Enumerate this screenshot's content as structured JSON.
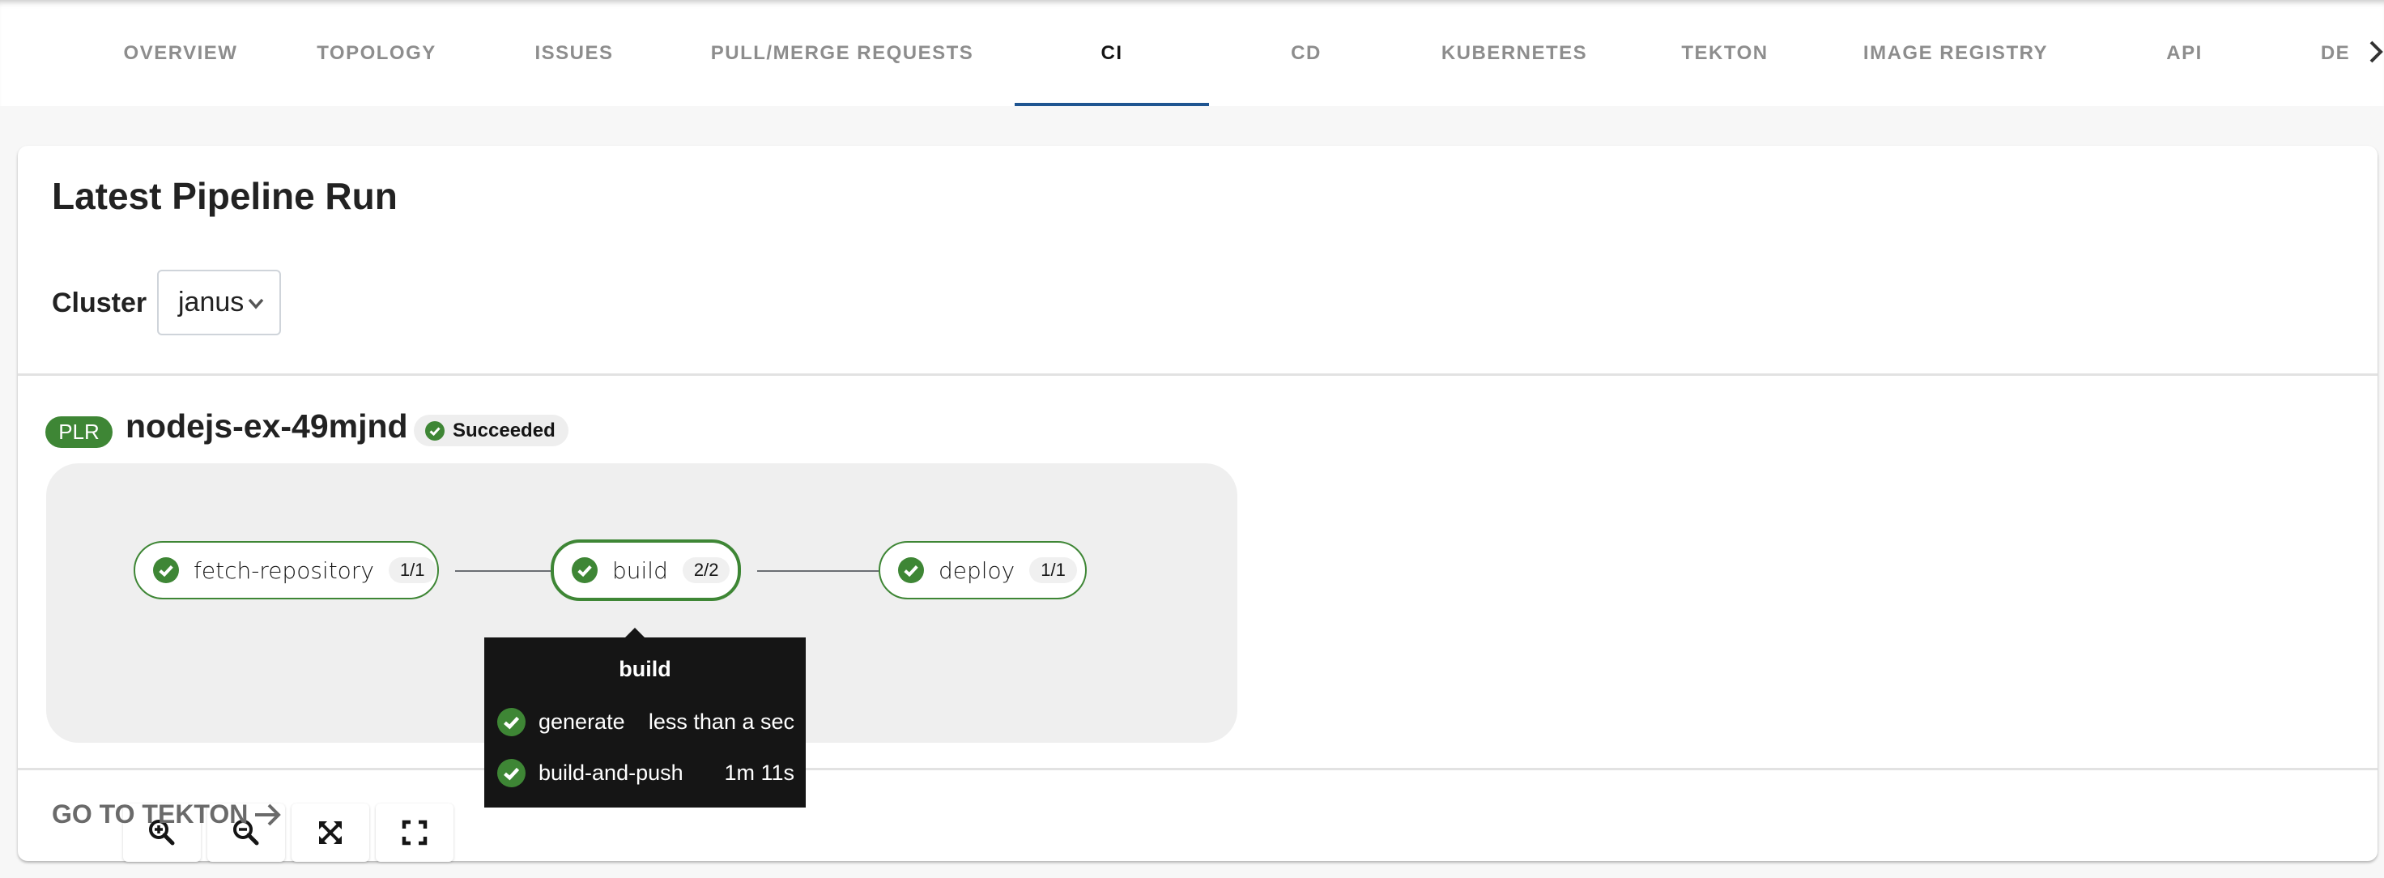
{
  "tabs": [
    {
      "label": "OVERVIEW",
      "active": false
    },
    {
      "label": "TOPOLOGY",
      "active": false
    },
    {
      "label": "ISSUES",
      "active": false
    },
    {
      "label": "PULL/MERGE REQUESTS",
      "active": false
    },
    {
      "label": "CI",
      "active": true
    },
    {
      "label": "CD",
      "active": false
    },
    {
      "label": "KUBERNETES",
      "active": false
    },
    {
      "label": "TEKTON",
      "active": false
    },
    {
      "label": "IMAGE REGISTRY",
      "active": false
    },
    {
      "label": "API",
      "active": false
    },
    {
      "label": "DE",
      "active": false
    }
  ],
  "tab_scroll_icon": "chevron-right",
  "card": {
    "title": "Latest Pipeline Run",
    "cluster_label": "Cluster",
    "cluster_value": "janus"
  },
  "run": {
    "badge": "PLR",
    "name": "nodejs-ex-49mjnd",
    "status": "Succeeded"
  },
  "pipeline": {
    "nodes": [
      {
        "label": "fetch-repository",
        "count": "1/1",
        "status": "succeeded"
      },
      {
        "label": "build",
        "count": "2/2",
        "status": "succeeded",
        "selected": true
      },
      {
        "label": "deploy",
        "count": "1/1",
        "status": "succeeded"
      }
    ],
    "controls": [
      "zoom-in",
      "zoom-out",
      "fit-to-screen",
      "reset-view"
    ]
  },
  "tooltip": {
    "title": "build",
    "steps": [
      {
        "name": "generate",
        "time": "less than a sec"
      },
      {
        "name": "build-and-push",
        "time": "1m 11s"
      }
    ]
  },
  "footer": {
    "link_label": "GO TO TEKTON"
  },
  "colors": {
    "success": "#3e8635",
    "active_tab": "#1f5591"
  }
}
